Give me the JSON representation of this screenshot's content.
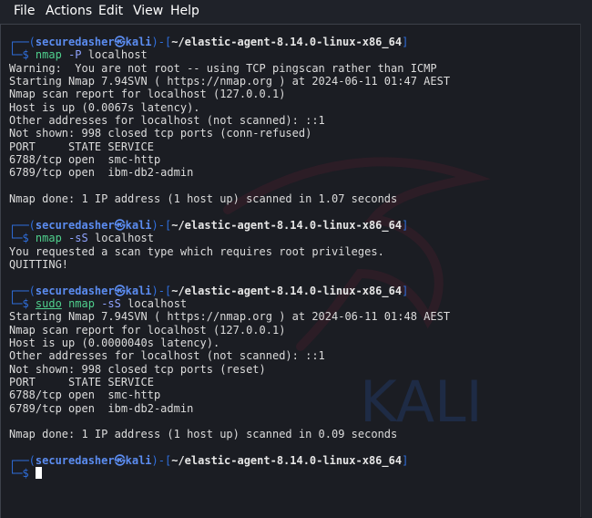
{
  "menu": {
    "file": "File",
    "actions": "Actions",
    "edit": "Edit",
    "view": "View",
    "help": "Help"
  },
  "watermark": {
    "text": "KALI"
  },
  "prompt": {
    "top_left": "┌──(",
    "user": "securedasher",
    "at_icon": "㉿",
    "host": "kali",
    "mid": ")-[",
    "path": "~/elastic-agent-8.14.0-linux-x86_64",
    "close": "]",
    "bottom_left": "└─",
    "dollar": "$",
    "space": " "
  },
  "blocks": [
    {
      "cmd": "nmap",
      "sudo": "",
      "args": "-P",
      "target": "localhost",
      "output": [
        "Warning:  You are not root -- using TCP pingscan rather than ICMP",
        "Starting Nmap 7.94SVN ( https://nmap.org ) at 2024-06-11 01:47 AEST",
        "Nmap scan report for localhost (127.0.0.1)",
        "Host is up (0.0067s latency).",
        "Other addresses for localhost (not scanned): ::1",
        "Not shown: 998 closed tcp ports (conn-refused)",
        "PORT     STATE SERVICE",
        "6788/tcp open  smc-http",
        "6789/tcp open  ibm-db2-admin",
        "",
        "Nmap done: 1 IP address (1 host up) scanned in 1.07 seconds",
        ""
      ]
    },
    {
      "cmd": "nmap",
      "sudo": "",
      "args": "-sS",
      "target": "localhost",
      "output": [
        "You requested a scan type which requires root privileges.",
        "QUITTING!",
        ""
      ]
    },
    {
      "cmd": "nmap",
      "sudo": "sudo",
      "args": "-sS",
      "target": "localhost",
      "output": [
        "Starting Nmap 7.94SVN ( https://nmap.org ) at 2024-06-11 01:48 AEST",
        "Nmap scan report for localhost (127.0.0.1)",
        "Host is up (0.0000040s latency).",
        "Other addresses for localhost (not scanned): ::1",
        "Not shown: 998 closed tcp ports (reset)",
        "PORT     STATE SERVICE",
        "6788/tcp open  smc-http",
        "6789/tcp open  ibm-db2-admin",
        "",
        "Nmap done: 1 IP address (1 host up) scanned in 0.09 seconds",
        ""
      ]
    }
  ],
  "colors": {
    "background": "#1b1d23",
    "prompt_frame": "#2f6fde",
    "prompt_user": "#5b8cf0",
    "command": "#4fd08d",
    "argument": "#8fa3ff",
    "text": "#dcdcdc"
  }
}
